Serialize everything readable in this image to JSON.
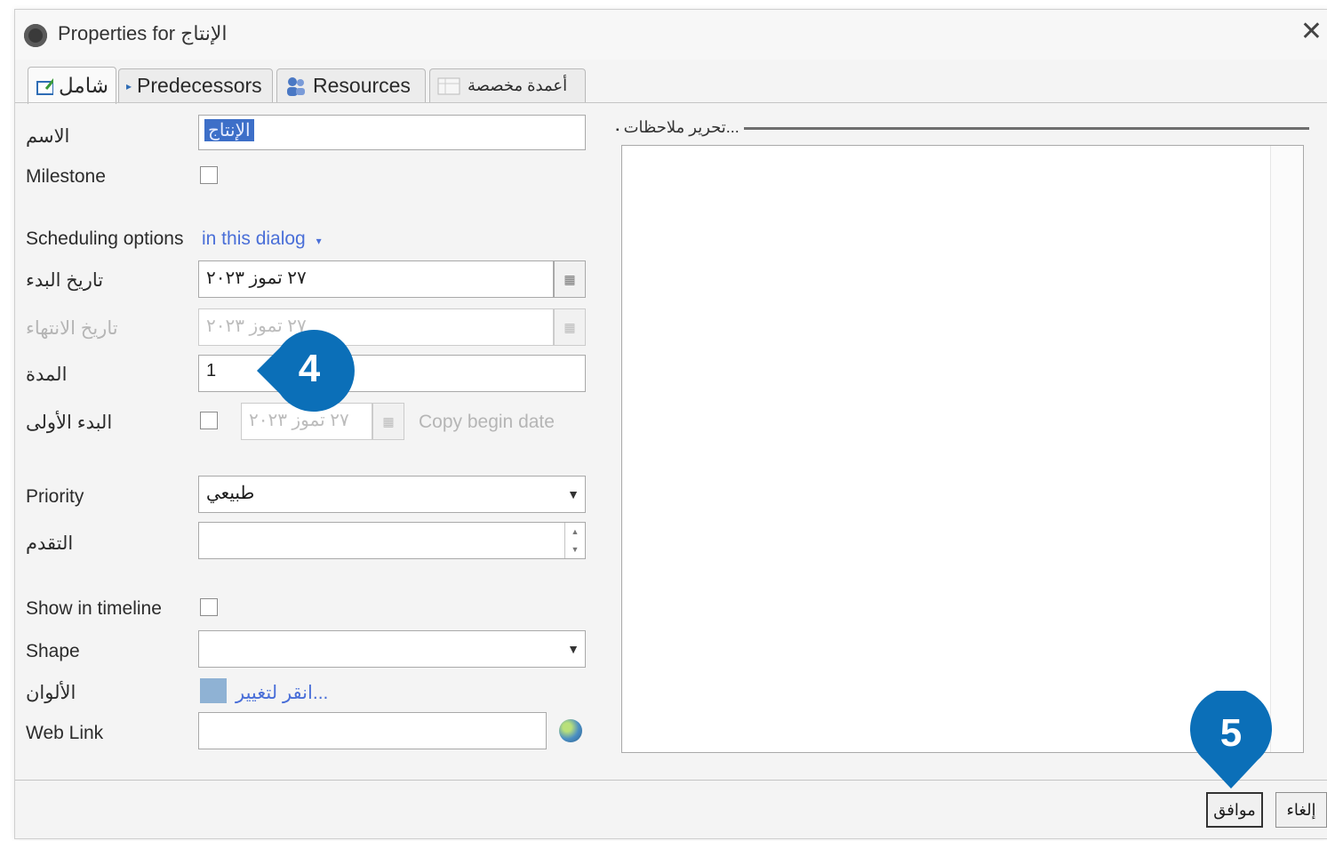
{
  "window": {
    "title": "Properties for الإنتاج",
    "close_glyph": "✕"
  },
  "tabs": [
    {
      "label": "شامل",
      "icon": "edit-icon",
      "active": true
    },
    {
      "label": "Predecessors",
      "icon": "arrow-icon",
      "active": false
    },
    {
      "label": "Resources",
      "icon": "people-icon",
      "active": false
    },
    {
      "label": "أعمدة مخصصة",
      "icon": "table-icon",
      "active": false
    }
  ],
  "form": {
    "name_label": "الاسم",
    "name_value": "الإنتاج",
    "milestone_label": "Milestone",
    "scheduling_label": "Scheduling options",
    "scheduling_link": "in this dialog",
    "begin_date_label": "تاريخ البدء",
    "begin_date_value": "٢٧ تموز ٢٠٢٣",
    "end_date_label": "تاريخ الانتهاء",
    "end_date_value": "٢٧ تموز ٢٠٢٣",
    "duration_label": "المدة",
    "duration_value": "1",
    "early_start_label": "البدء الأولى",
    "early_start_value": "٢٧ تموز ٢٠٢٣",
    "copy_begin_label": "Copy begin date",
    "priority_label": "Priority",
    "priority_value": "طبيعي",
    "progress_label": "التقدم",
    "progress_value": "",
    "show_timeline_label": "Show in timeline",
    "shape_label": "Shape",
    "shape_value": "",
    "color_label": "الألوان",
    "color_link": "انقر لتغيير...",
    "color_swatch": "#8fb2d4",
    "weblink_label": "Web Link",
    "weblink_value": ""
  },
  "notes": {
    "label": "تحرير ملاحظات..."
  },
  "buttons": {
    "ok": "موافق",
    "cancel": "إلغاء"
  },
  "callouts": {
    "step4": "4",
    "step5": "5"
  },
  "colors": {
    "accent": "#0b6fb8",
    "selection": "#3d6fc8"
  }
}
